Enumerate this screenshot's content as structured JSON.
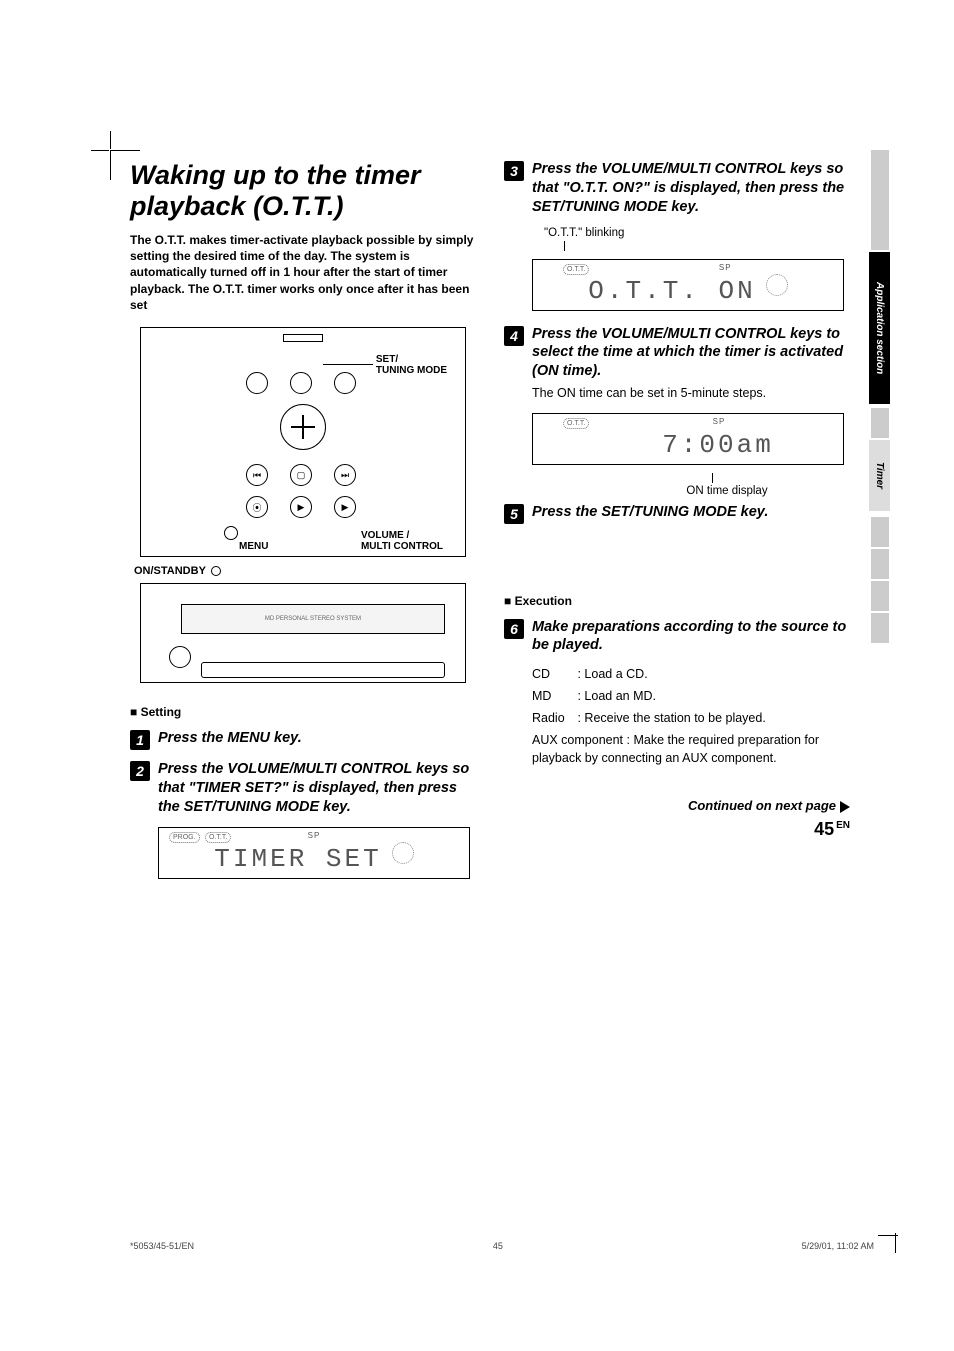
{
  "title": "Waking up to the timer playback (O.T.T.)",
  "intro": "The O.T.T. makes timer-activate playback possible by simply setting the desired time of the day. The system is automatically turned off in 1 hour after the start of timer playback. The O.T.T. timer works only once after it has been set",
  "device_labels": {
    "set_tuning": "SET/\nTUNING MODE",
    "menu": "MENU",
    "volume": "VOLUME /\nMULTI CONTROL",
    "standby": "ON/STANDBY "
  },
  "setting_heading": "■ Setting",
  "execution_heading": "■ Execution",
  "steps": {
    "s1": "Press the MENU key.",
    "s2": "Press the VOLUME/MULTI CONTROL keys  so that \"TIMER SET?\" is displayed, then press the SET/TUNING MODE key.",
    "s3": "Press the VOLUME/MULTI CONTROL keys so that \"O.T.T. ON?\" is displayed, then press the SET/TUNING MODE key.",
    "s4": "Press the VOLUME/MULTI CONTROL keys to select the time at which the timer is activated (ON time).",
    "s4_sub": "The ON time can be set in 5-minute steps.",
    "s5": "Press the SET/TUNING MODE key.",
    "s6": "Make preparations according to the source to be played."
  },
  "blink_note": "\"O.T.T.\" blinking",
  "displays": {
    "timer_set": "TIMER SET",
    "ott_on": "O.T.T. ON",
    "time": "7:00am",
    "sp": "SP",
    "prog": "PROG.",
    "ott_badge": "O.T.T."
  },
  "ontime_caption": "ON time display",
  "sources": {
    "cd": {
      "label": "CD",
      "text": ": Load a CD."
    },
    "md": {
      "label": "MD",
      "text": ": Load an MD."
    },
    "radio": {
      "label": "Radio",
      "text": ": Receive the station to be played."
    },
    "aux": {
      "label": "AUX component",
      "text": ":  Make the required preparation for playback by connecting  an AUX component."
    }
  },
  "continued": "Continued on next page",
  "page_number": "45",
  "page_lang": "EN",
  "side": {
    "app": "Application\nsection",
    "timer": "Timer"
  },
  "footer": {
    "left": "*5053/45-51/EN",
    "center": "45",
    "right": "5/29/01, 11:02 AM"
  },
  "chart_data": null
}
